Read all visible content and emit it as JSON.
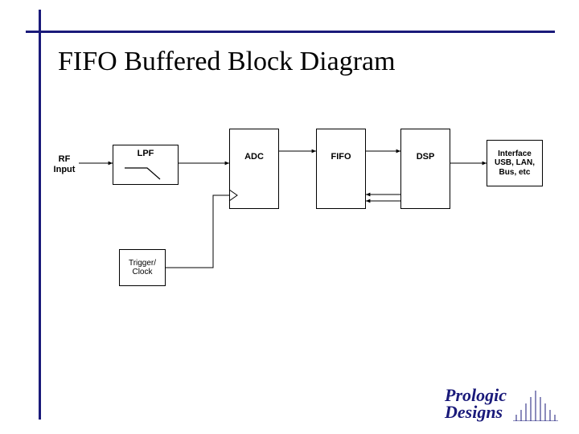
{
  "title": "FIFO Buffered Block Diagram",
  "input_label": "RF\nInput",
  "blocks": {
    "lpf": {
      "label": "LPF"
    },
    "adc": {
      "label": "ADC"
    },
    "fifo": {
      "label": "FIFO"
    },
    "dsp": {
      "label": "DSP"
    },
    "trigger": {
      "label": "Trigger/\nClock"
    },
    "iface": {
      "label": "Interface\nUSB, LAN,\nBus, etc"
    }
  },
  "logo": {
    "line1": "Prologic",
    "line2": "Designs"
  }
}
